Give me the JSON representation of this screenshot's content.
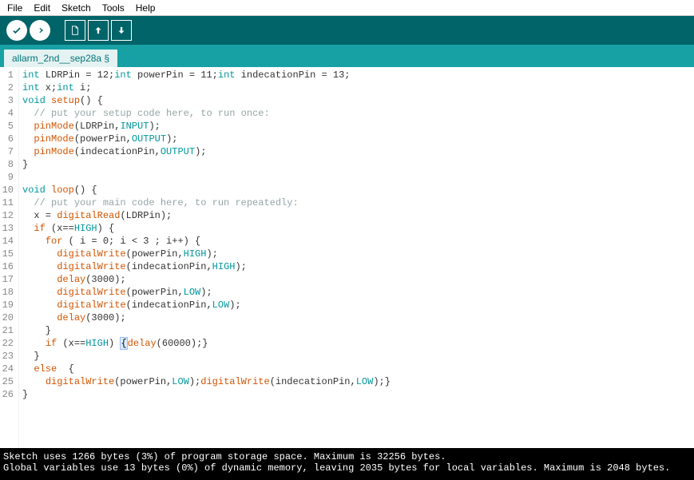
{
  "menubar": {
    "items": [
      "File",
      "Edit",
      "Sketch",
      "Tools",
      "Help"
    ]
  },
  "toolbar": {
    "verify": "verify",
    "upload": "upload",
    "new": "new",
    "open": "open",
    "save": "save"
  },
  "tabs": [
    {
      "label": "allarm_2nd__sep28a §"
    }
  ],
  "code": {
    "lines": [
      {
        "n": 1,
        "t": [
          [
            "kw-type",
            "int"
          ],
          [
            "plain",
            " LDRPin = 12;"
          ],
          [
            "kw-type",
            "int"
          ],
          [
            "plain",
            " powerPin = 11;"
          ],
          [
            "kw-type",
            "int"
          ],
          [
            "plain",
            " indecationPin = 13;"
          ]
        ]
      },
      {
        "n": 2,
        "t": [
          [
            "kw-type",
            "int"
          ],
          [
            "plain",
            " x;"
          ],
          [
            "kw-type",
            "int"
          ],
          [
            "plain",
            " i;"
          ]
        ]
      },
      {
        "n": 3,
        "t": [
          [
            "kw-type",
            "void"
          ],
          [
            "plain",
            " "
          ],
          [
            "kw-func",
            "setup"
          ],
          [
            "plain",
            "() {"
          ]
        ]
      },
      {
        "n": 4,
        "t": [
          [
            "plain",
            "  "
          ],
          [
            "comment",
            "// put your setup code here, to run once:"
          ]
        ]
      },
      {
        "n": 5,
        "t": [
          [
            "plain",
            "  "
          ],
          [
            "kw-func",
            "pinMode"
          ],
          [
            "plain",
            "(LDRPin,"
          ],
          [
            "kw-const",
            "INPUT"
          ],
          [
            "plain",
            ");"
          ]
        ]
      },
      {
        "n": 6,
        "t": [
          [
            "plain",
            "  "
          ],
          [
            "kw-func",
            "pinMode"
          ],
          [
            "plain",
            "(powerPin,"
          ],
          [
            "kw-const",
            "OUTPUT"
          ],
          [
            "plain",
            ");"
          ]
        ]
      },
      {
        "n": 7,
        "t": [
          [
            "plain",
            "  "
          ],
          [
            "kw-func",
            "pinMode"
          ],
          [
            "plain",
            "(indecationPin,"
          ],
          [
            "kw-const",
            "OUTPUT"
          ],
          [
            "plain",
            ");"
          ]
        ]
      },
      {
        "n": 8,
        "t": [
          [
            "plain",
            "}"
          ]
        ]
      },
      {
        "n": 9,
        "t": [
          [
            "plain",
            ""
          ]
        ]
      },
      {
        "n": 10,
        "t": [
          [
            "kw-type",
            "void"
          ],
          [
            "plain",
            " "
          ],
          [
            "kw-func",
            "loop"
          ],
          [
            "plain",
            "() {"
          ]
        ]
      },
      {
        "n": 11,
        "t": [
          [
            "plain",
            "  "
          ],
          [
            "comment",
            "// put your main code here, to run repeatedly:"
          ]
        ]
      },
      {
        "n": 12,
        "t": [
          [
            "plain",
            "  x = "
          ],
          [
            "kw-func",
            "digitalRead"
          ],
          [
            "plain",
            "(LDRPin);"
          ]
        ]
      },
      {
        "n": 13,
        "t": [
          [
            "plain",
            "  "
          ],
          [
            "kw-func",
            "if"
          ],
          [
            "plain",
            " (x=="
          ],
          [
            "kw-const",
            "HIGH"
          ],
          [
            "plain",
            ") {"
          ]
        ]
      },
      {
        "n": 14,
        "t": [
          [
            "plain",
            "    "
          ],
          [
            "kw-func",
            "for"
          ],
          [
            "plain",
            " ( i = 0; i < 3 ; i++) {"
          ]
        ]
      },
      {
        "n": 15,
        "t": [
          [
            "plain",
            "      "
          ],
          [
            "kw-func",
            "digitalWrite"
          ],
          [
            "plain",
            "(powerPin,"
          ],
          [
            "kw-const",
            "HIGH"
          ],
          [
            "plain",
            ");"
          ]
        ]
      },
      {
        "n": 16,
        "t": [
          [
            "plain",
            "      "
          ],
          [
            "kw-func",
            "digitalWrite"
          ],
          [
            "plain",
            "(indecationPin,"
          ],
          [
            "kw-const",
            "HIGH"
          ],
          [
            "plain",
            ");"
          ]
        ]
      },
      {
        "n": 17,
        "t": [
          [
            "plain",
            "      "
          ],
          [
            "kw-func",
            "delay"
          ],
          [
            "plain",
            "(3000);"
          ]
        ]
      },
      {
        "n": 18,
        "t": [
          [
            "plain",
            "      "
          ],
          [
            "kw-func",
            "digitalWrite"
          ],
          [
            "plain",
            "(powerPin,"
          ],
          [
            "kw-const",
            "LOW"
          ],
          [
            "plain",
            ");"
          ]
        ]
      },
      {
        "n": 19,
        "t": [
          [
            "plain",
            "      "
          ],
          [
            "kw-func",
            "digitalWrite"
          ],
          [
            "plain",
            "(indecationPin,"
          ],
          [
            "kw-const",
            "LOW"
          ],
          [
            "plain",
            ");"
          ]
        ]
      },
      {
        "n": 20,
        "t": [
          [
            "plain",
            "      "
          ],
          [
            "kw-func",
            "delay"
          ],
          [
            "plain",
            "(3000);"
          ]
        ]
      },
      {
        "n": 21,
        "t": [
          [
            "plain",
            "    }"
          ]
        ]
      },
      {
        "n": 22,
        "t": [
          [
            "plain",
            "    "
          ],
          [
            "kw-func",
            "if"
          ],
          [
            "plain",
            " (x=="
          ],
          [
            "kw-const",
            "HIGH"
          ],
          [
            "plain",
            ") "
          ],
          [
            "match-bracket",
            "{"
          ],
          [
            "kw-func",
            "delay"
          ],
          [
            "plain",
            "(60000);}"
          ]
        ]
      },
      {
        "n": 23,
        "t": [
          [
            "plain",
            "  }"
          ]
        ]
      },
      {
        "n": 24,
        "t": [
          [
            "plain",
            "  "
          ],
          [
            "kw-func",
            "else"
          ],
          [
            "plain",
            "  {"
          ]
        ]
      },
      {
        "n": 25,
        "t": [
          [
            "plain",
            "    "
          ],
          [
            "kw-func",
            "digitalWrite"
          ],
          [
            "plain",
            "(powerPin,"
          ],
          [
            "kw-const",
            "LOW"
          ],
          [
            "plain",
            ");"
          ],
          [
            "kw-func",
            "digitalWrite"
          ],
          [
            "plain",
            "(indecationPin,"
          ],
          [
            "kw-const",
            "LOW"
          ],
          [
            "plain",
            ");}"
          ]
        ]
      },
      {
        "n": 26,
        "t": [
          [
            "plain",
            "}"
          ]
        ]
      }
    ]
  },
  "console": {
    "lines": [
      "Sketch uses 1266 bytes (3%) of program storage space. Maximum is 32256 bytes.",
      "Global variables use 13 bytes (0%) of dynamic memory, leaving 2035 bytes for local variables. Maximum is 2048 bytes."
    ]
  }
}
